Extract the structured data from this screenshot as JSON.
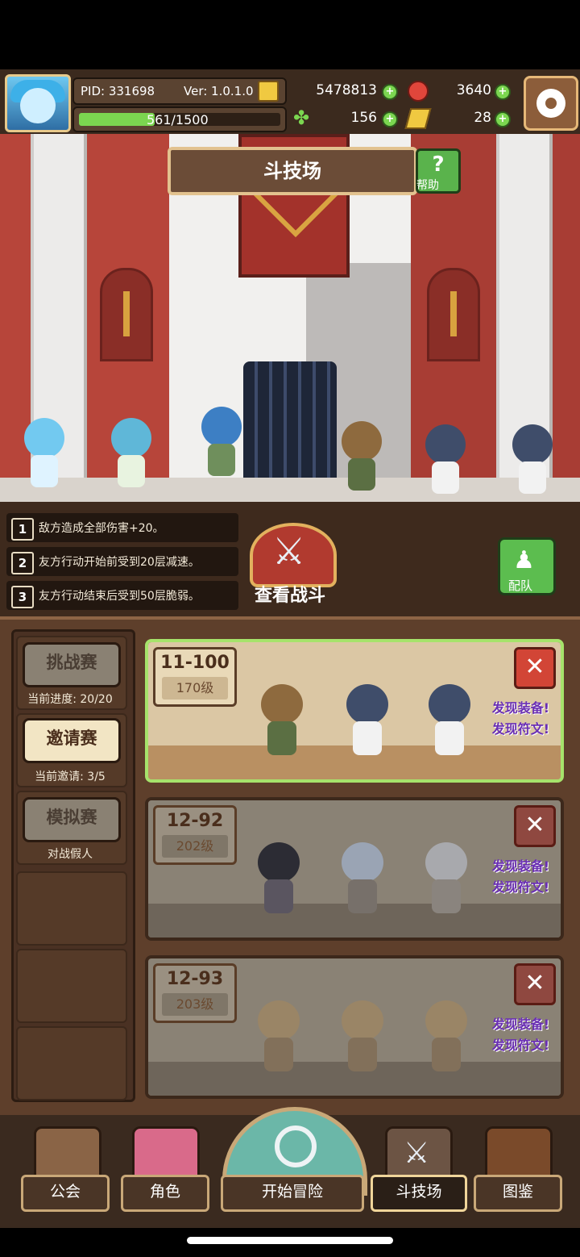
{
  "status": {
    "pid": "PID: 331698",
    "version": "Ver: 1.0.1.0",
    "gold": "5478813",
    "gems": "3640",
    "clover": "156",
    "tickets": "28",
    "stamina": "561/1500",
    "stamina_fraction": 0.374
  },
  "arena": {
    "title": "斗技场",
    "help_label": "帮助",
    "rules": [
      {
        "num": "1",
        "text": "敌方造成全部伤害+20。"
      },
      {
        "num": "2",
        "text": "友方行动开始前受到20层减速。"
      },
      {
        "num": "3",
        "text": "友方行动结束后受到50层脆弱。"
      }
    ],
    "view_battle_label": "查看战斗",
    "team_label": "配队"
  },
  "modes": [
    {
      "label": "挑战赛",
      "sub": "当前进度: 20/20",
      "selected": false
    },
    {
      "label": "邀请赛",
      "sub": "当前邀请: 3/5",
      "selected": true
    },
    {
      "label": "模拟赛",
      "sub": "对战假人",
      "selected": false
    }
  ],
  "opponents": [
    {
      "rank": "11-100",
      "level": "170级",
      "found_equip": "发现装备!",
      "found_rune": "发现符文!",
      "active": true
    },
    {
      "rank": "12-92",
      "level": "202级",
      "found_equip": "发现装备!",
      "found_rune": "发现符文!",
      "active": false
    },
    {
      "rank": "12-93",
      "level": "203级",
      "found_equip": "发现装备!",
      "found_rune": "发现符文!",
      "active": false
    }
  ],
  "nav": {
    "guild": "公会",
    "character": "角色",
    "adventure": "开始冒险",
    "arena": "斗技场",
    "codex": "图鉴"
  },
  "colors": {
    "accent_green": "#a6e36b",
    "found_text": "#6a2fb4",
    "close_red": "#d24536"
  }
}
